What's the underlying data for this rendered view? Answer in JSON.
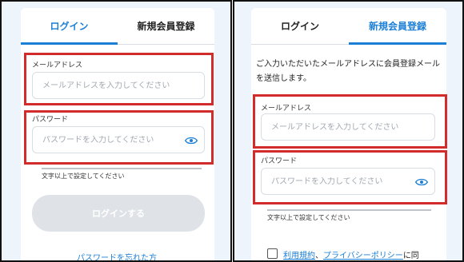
{
  "login_panel": {
    "tabs": [
      {
        "label": "ログイン",
        "active": true
      },
      {
        "label": "新規会員登録",
        "active": false
      }
    ],
    "email": {
      "label": "メールアドレス",
      "placeholder": "メールアドレスを入力してください"
    },
    "password": {
      "label": "パスワード",
      "placeholder": "パスワードを入力してください"
    },
    "password_hint": "文字以上で設定してください",
    "login_button": "ログインする",
    "forgot_password_link": "パスワードを忘れた方"
  },
  "register_panel": {
    "tabs": [
      {
        "label": "ログイン",
        "active": false
      },
      {
        "label": "新規会員登録",
        "active": true
      }
    ],
    "description": "ご入力いただいたメールアドレスに会員登録メールを送信します。",
    "email": {
      "label": "メールアドレス",
      "placeholder": "メールアドレスを入力してください"
    },
    "password": {
      "label": "パスワード",
      "placeholder": "パスワードを入力してください"
    },
    "password_hint": "文字以上で設定してください",
    "terms": {
      "link1": "利用規約",
      "sep": "、",
      "link2": "プライバシーポリシー",
      "suffix": "に同"
    }
  },
  "colors": {
    "accent": "#1b7fd6",
    "highlight": "#d22b2b",
    "background": "#eef4fb"
  }
}
